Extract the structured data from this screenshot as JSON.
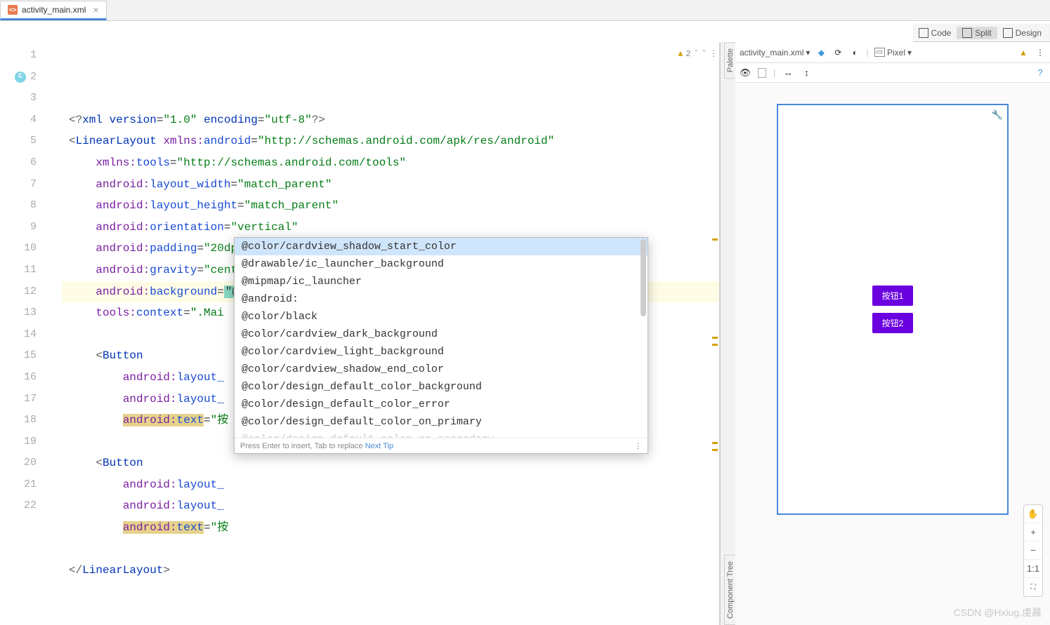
{
  "tab": {
    "filename": "activity_main.xml",
    "icon_text": "<>"
  },
  "view_modes": {
    "code": "Code",
    "split": "Split",
    "design": "Design",
    "active": "Split"
  },
  "editor": {
    "warning_count": "2",
    "lines": [
      {
        "n": "1",
        "html": "<span class='k-decl'>&lt;?</span><span class='k-tag'>xml version</span><span class='k-eq'>=</span><span class='k-val'>\"1.0\"</span> <span class='k-tag'>encoding</span><span class='k-eq'>=</span><span class='k-val'>\"utf-8\"</span><span class='k-decl'>?&gt;</span>"
      },
      {
        "n": "2",
        "marker": "C",
        "html": "<span class='k-decl'>&lt;</span><span class='k-tag'>LinearLayout</span> <span class='k-ns'>xmlns:</span><span class='k-attr'>android</span><span class='k-eq'>=</span><span class='k-val'>\"http://schemas.android.com/apk/res/android\"</span>"
      },
      {
        "n": "3",
        "html": "    <span class='k-ns'>xmlns:</span><span class='k-attr'>tools</span><span class='k-eq'>=</span><span class='k-val'>\"http://schemas.android.com/tools\"</span>"
      },
      {
        "n": "4",
        "html": "    <span class='k-ns'>android:</span><span class='k-attr'>layout_width</span><span class='k-eq'>=</span><span class='k-val'>\"match_parent\"</span>"
      },
      {
        "n": "5",
        "html": "    <span class='k-ns'>android:</span><span class='k-attr'>layout_height</span><span class='k-eq'>=</span><span class='k-val'>\"match_parent\"</span>"
      },
      {
        "n": "6",
        "html": "    <span class='k-ns'>android:</span><span class='k-attr'>orientation</span><span class='k-eq'>=</span><span class='k-val'>\"vertical\"</span>"
      },
      {
        "n": "7",
        "html": "    <span class='k-ns'>android:</span><span class='k-attr'>padding</span><span class='k-eq'>=</span><span class='k-val'>\"20dp\"</span>"
      },
      {
        "n": "8",
        "html": "    <span class='k-ns'>android:</span><span class='k-attr'>gravity</span><span class='k-eq'>=</span><span class='k-val'>\"center\"</span>"
      },
      {
        "n": "9",
        "hl": true,
        "html": "    <span class='k-ns'>android:</span><span class='k-attr'>background</span><span class='k-eq'>=</span><span class='cursor-box'>\"@\"</span>"
      },
      {
        "n": "10",
        "html": "    <span class='k-ns'>tools:</span><span class='k-attr'>context</span><span class='k-eq'>=</span><span class='k-val'>\".Mai</span>"
      },
      {
        "n": "11",
        "html": ""
      },
      {
        "n": "12",
        "html": "    <span class='k-decl'>&lt;</span><span class='k-tag'>Button</span>"
      },
      {
        "n": "13",
        "html": "        <span class='k-ns'>android:</span><span class='k-attr'>layout_</span>"
      },
      {
        "n": "14",
        "html": "        <span class='k-ns'>android:</span><span class='k-attr'>layout_</span>"
      },
      {
        "n": "15",
        "html": "        <span class='k-text-hl'><span class='k-ns'>android:</span><span class='k-attr'>text</span></span><span class='k-eq'>=</span><span class='k-val'>\"按</span>"
      },
      {
        "n": "16",
        "html": ""
      },
      {
        "n": "17",
        "html": "    <span class='k-decl'>&lt;</span><span class='k-tag'>Button</span>"
      },
      {
        "n": "18",
        "html": "        <span class='k-ns'>android:</span><span class='k-attr'>layout_</span>"
      },
      {
        "n": "19",
        "html": "        <span class='k-ns'>android:</span><span class='k-attr'>layout_</span>"
      },
      {
        "n": "20",
        "html": "        <span class='k-text-hl'><span class='k-ns'>android:</span><span class='k-attr'>text</span></span><span class='k-eq'>=</span><span class='k-val'>\"按</span>"
      },
      {
        "n": "21",
        "html": ""
      },
      {
        "n": "22",
        "html": "<span class='k-decl'>&lt;/</span><span class='k-tag'>LinearLayout</span><span class='k-decl'>&gt;</span>"
      }
    ]
  },
  "completion": {
    "items": [
      "@color/cardview_shadow_start_color",
      "@drawable/ic_launcher_background",
      "@mipmap/ic_launcher",
      "@android:",
      "@color/black",
      "@color/cardview_dark_background",
      "@color/cardview_light_background",
      "@color/cardview_shadow_end_color",
      "@color/design_default_color_background",
      "@color/design_default_color_error",
      "@color/design_default_color_on_primary"
    ],
    "truncated_last": "@color/design_default_color_on_secondary",
    "footer_hint": "Press Enter to insert, Tab to replace",
    "footer_link": "Next Tip"
  },
  "side_labels": {
    "palette": "Palette",
    "component_tree": "Component Tree"
  },
  "designer": {
    "file_dd": "activity_main.xml",
    "device": "Pixel",
    "buttons": {
      "b1": "按钮1",
      "b2": "按钮2"
    },
    "zoom": {
      "plus": "+",
      "minus": "−",
      "fit": "1:1",
      "hand": "✋",
      "box": "⛶"
    }
  },
  "watermark": "CSDN @Hxiug.虔晨"
}
